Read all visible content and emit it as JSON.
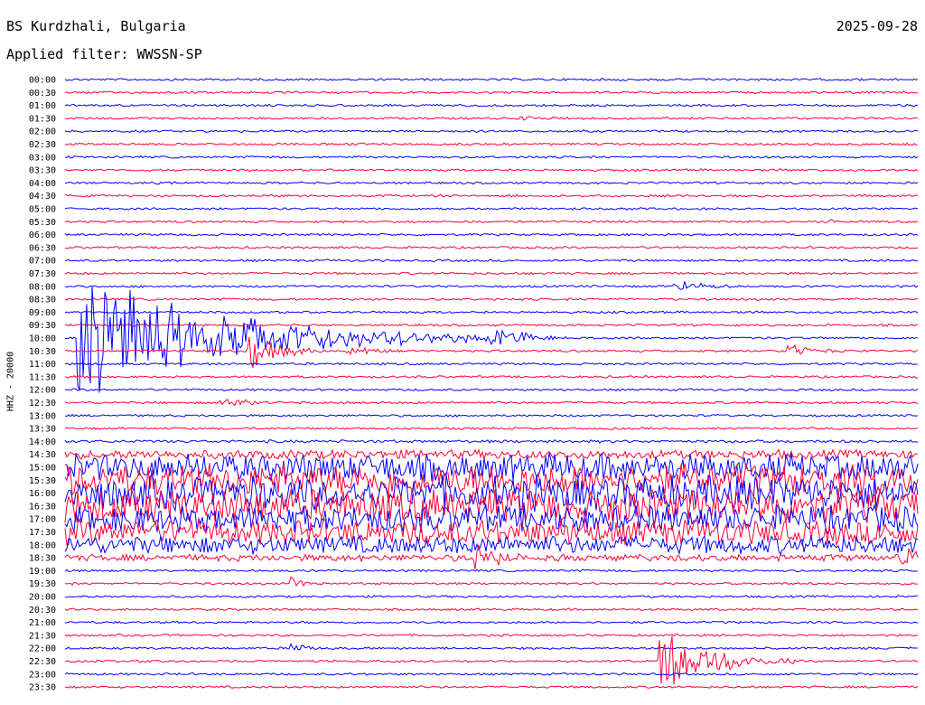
{
  "header": {
    "station": "BS Kurdzhali, Bulgaria",
    "date": "2025-09-28",
    "filter_label": "Applied filter: WWSSN-SP"
  },
  "channel": "HHZ - 20000",
  "chart_data": {
    "type": "line",
    "description_kind": "helicorder",
    "colors": [
      "#0000ff",
      "#ff0033"
    ],
    "rows": [
      "00:00",
      "00:30",
      "01:00",
      "01:30",
      "02:00",
      "02:30",
      "03:00",
      "03:30",
      "04:00",
      "04:30",
      "05:00",
      "05:30",
      "06:00",
      "06:30",
      "07:00",
      "07:30",
      "08:00",
      "08:30",
      "09:00",
      "09:30",
      "10:00",
      "10:30",
      "11:00",
      "11:30",
      "12:00",
      "12:30",
      "13:00",
      "13:30",
      "14:00",
      "14:30",
      "15:00",
      "15:30",
      "16:00",
      "16:30",
      "17:00",
      "17:30",
      "18:00",
      "18:30",
      "19:00",
      "19:30",
      "20:00",
      "20:30",
      "21:00",
      "21:30",
      "22:00",
      "22:30",
      "23:00",
      "23:30"
    ],
    "minutes_per_row": 30,
    "noise_by_row": [
      1,
      1,
      1,
      1,
      1,
      1,
      1,
      1,
      1,
      1,
      1,
      1,
      1,
      1,
      1,
      1,
      1,
      1,
      1,
      1,
      1,
      1,
      1,
      1,
      1,
      1,
      1,
      1,
      1.3,
      4,
      12,
      14,
      15,
      15,
      12,
      11,
      8,
      3,
      1,
      1,
      1,
      1,
      1,
      1,
      1,
      1,
      1,
      1
    ],
    "events": [
      {
        "row": 0,
        "minute": 19.5,
        "amp": 3,
        "dur": 2
      },
      {
        "row": 1,
        "minute": 9.5,
        "amp": 2,
        "dur": 1
      },
      {
        "row": 2,
        "minute": 19,
        "amp": 2,
        "dur": 2
      },
      {
        "row": 3,
        "minute": 16,
        "amp": 5,
        "dur": 2
      },
      {
        "row": 5,
        "minute": 8,
        "amp": 2,
        "dur": 1
      },
      {
        "row": 11,
        "minute": 27,
        "amp": 4,
        "dur": 1
      },
      {
        "row": 16,
        "minute": 21.5,
        "amp": 10,
        "dur": 2
      },
      {
        "row": 19,
        "minute": 26,
        "amp": 2,
        "dur": 1
      },
      {
        "row": 20,
        "minute": 0.5,
        "amp": 80,
        "dur": 10
      },
      {
        "row": 20,
        "minute": 8,
        "amp": 12,
        "dur": 2
      },
      {
        "row": 20,
        "minute": 15,
        "amp": 20,
        "dur": 2
      },
      {
        "row": 21,
        "minute": 6.5,
        "amp": 25,
        "dur": 2
      },
      {
        "row": 21,
        "minute": 10,
        "amp": 8,
        "dur": 2
      },
      {
        "row": 21,
        "minute": 25.5,
        "amp": 10,
        "dur": 2
      },
      {
        "row": 25,
        "minute": 5.5,
        "amp": 10,
        "dur": 2
      },
      {
        "row": 37,
        "minute": 14.5,
        "amp": 20,
        "dur": 2
      },
      {
        "row": 37,
        "minute": 29.5,
        "amp": 20,
        "dur": 1
      },
      {
        "row": 39,
        "minute": 8,
        "amp": 10,
        "dur": 1
      },
      {
        "row": 44,
        "minute": 8,
        "amp": 8,
        "dur": 1
      },
      {
        "row": 45,
        "minute": 21,
        "amp": 50,
        "dur": 3
      }
    ],
    "xlim": [
      0,
      30
    ]
  }
}
